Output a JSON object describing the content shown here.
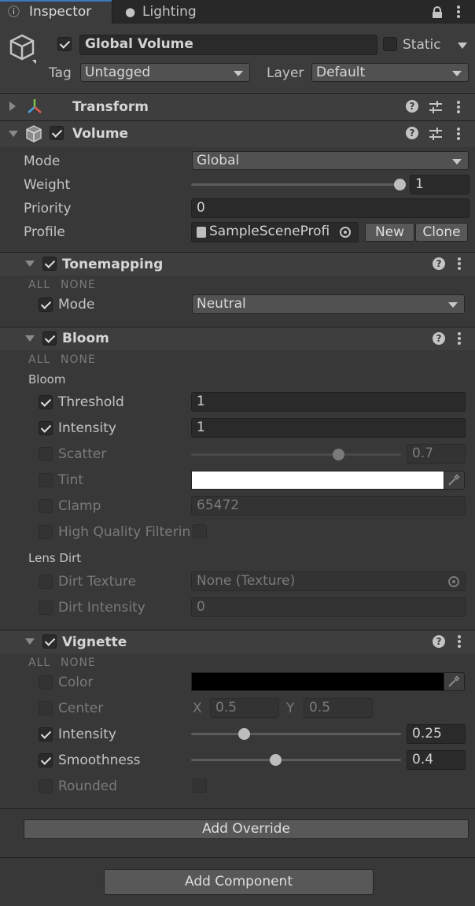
{
  "tabs": {
    "inspector": "Inspector",
    "lighting": "Lighting"
  },
  "object": {
    "name": "Global Volume",
    "active": true,
    "static_label": "Static",
    "tag_label": "Tag",
    "tag_value": "Untagged",
    "layer_label": "Layer",
    "layer_value": "Default"
  },
  "transform": {
    "title": "Transform"
  },
  "volume": {
    "title": "Volume",
    "mode_label": "Mode",
    "mode_value": "Global",
    "weight_label": "Weight",
    "weight_value": "1",
    "weight_fraction": 1.0,
    "priority_label": "Priority",
    "priority_value": "0",
    "profile_label": "Profile",
    "profile_value": "SampleSceneProfi",
    "new_label": "New",
    "clone_label": "Clone"
  },
  "all_label": "ALL",
  "none_label": "NONE",
  "tonemapping": {
    "title": "Tonemapping",
    "mode_label": "Mode",
    "mode_value": "Neutral"
  },
  "bloom": {
    "title": "Bloom",
    "section_bloom": "Bloom",
    "threshold_label": "Threshold",
    "threshold_value": "1",
    "intensity_label": "Intensity",
    "intensity_value": "1",
    "scatter_label": "Scatter",
    "scatter_value": "0.7",
    "scatter_fraction": 0.7,
    "tint_label": "Tint",
    "tint_color": "#ffffff",
    "clamp_label": "Clamp",
    "clamp_value": "65472",
    "hq_label": "High Quality Filterin",
    "section_lens_dirt": "Lens Dirt",
    "dirt_texture_label": "Dirt Texture",
    "dirt_texture_value": "None (Texture)",
    "dirt_intensity_label": "Dirt Intensity",
    "dirt_intensity_value": "0"
  },
  "vignette": {
    "title": "Vignette",
    "color_label": "Color",
    "color_value": "#000000",
    "center_label": "Center",
    "center_x_label": "X",
    "center_x": "0.5",
    "center_y_label": "Y",
    "center_y": "0.5",
    "intensity_label": "Intensity",
    "intensity_value": "0.25",
    "intensity_fraction": 0.25,
    "smoothness_label": "Smoothness",
    "smoothness_value": "0.4",
    "smoothness_fraction": 0.4,
    "rounded_label": "Rounded"
  },
  "add_override_label": "Add Override",
  "add_component_label": "Add Component",
  "colors": {
    "accent": "#3a79bb",
    "background": "#383838",
    "header": "#3e3e3e"
  }
}
